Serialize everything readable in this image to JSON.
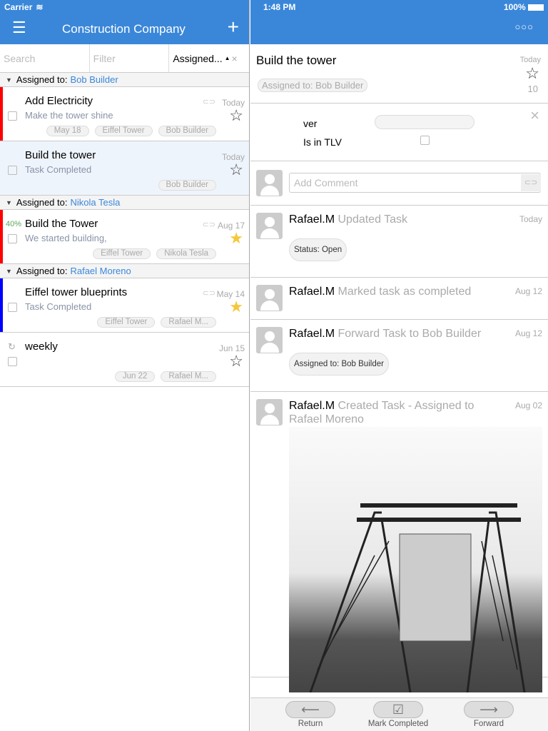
{
  "status_left": {
    "carrier": "Carrier",
    "time": "1:48 PM",
    "battery": "100%"
  },
  "nav": {
    "title": "Construction Company"
  },
  "search": {
    "search_placeholder": "Search",
    "filter_placeholder": "Filter",
    "sort": "Assigned..."
  },
  "groups": [
    {
      "label": "Assigned to:",
      "name": "Bob Builder",
      "tasks": [
        {
          "title": "Add Electricity",
          "sub": "Make the tower shine",
          "date": "Today",
          "chips": [
            "May 18",
            "Eiffel Tower",
            "Bob Builder"
          ],
          "bar": "#ff0000",
          "starred": false,
          "clip": true
        },
        {
          "title": "Build the tower",
          "sub": "Task Completed",
          "date": "Today",
          "chips": [
            "Bob Builder"
          ],
          "bar": "",
          "starred": false,
          "selected": true
        }
      ]
    },
    {
      "label": "Assigned to:",
      "name": "Nikola Tesla",
      "tasks": [
        {
          "title": "Build the Tower",
          "sub": "We started building,",
          "date": "Aug 17",
          "chips": [
            "Eiffel Tower",
            "Nikola Tesla"
          ],
          "bar": "#ff0000",
          "starred": true,
          "clip": true,
          "progress": "40%"
        }
      ]
    },
    {
      "label": "Assigned to:",
      "name": "Rafael Moreno",
      "tasks": [
        {
          "title": "Eiffel tower blueprints",
          "sub": "Task Completed",
          "date": "May 14",
          "chips": [
            "Eiffel Tower",
            "Rafael M..."
          ],
          "bar": "#0000ff",
          "starred": true,
          "clip": true
        },
        {
          "title": "weekly",
          "sub": "",
          "date": "Jun 15",
          "chips": [
            "Jun 22",
            "Rafael M..."
          ],
          "bar": "",
          "starred": false,
          "recurring": true
        }
      ]
    }
  ],
  "detail": {
    "title": "Build the tower",
    "date": "Today",
    "assigned": "Assigned to: Bob Builder",
    "star_count": "10",
    "fields": {
      "ver_label": "ver",
      "ver_value": "",
      "tlv_label": "Is in TLV"
    },
    "comment_placeholder": "Add Comment",
    "activity": [
      {
        "who": "Rafael.M",
        "what": "Updated Task",
        "date": "Today",
        "pill": "Status:  Open"
      },
      {
        "who": "Rafael.M",
        "what": "Marked task as completed",
        "date": "Aug 12"
      },
      {
        "who": "Rafael.M",
        "what": "Forward Task to  Bob Builder",
        "date": "Aug 12",
        "pill": "Assigned to:  Bob Builder"
      },
      {
        "who": "Rafael.M",
        "what": "Created Task - Assigned to Rafael Moreno",
        "date": "Aug 02"
      }
    ]
  },
  "toolbar": {
    "return": "Return",
    "complete": "Mark Completed",
    "forward": "Forward"
  }
}
